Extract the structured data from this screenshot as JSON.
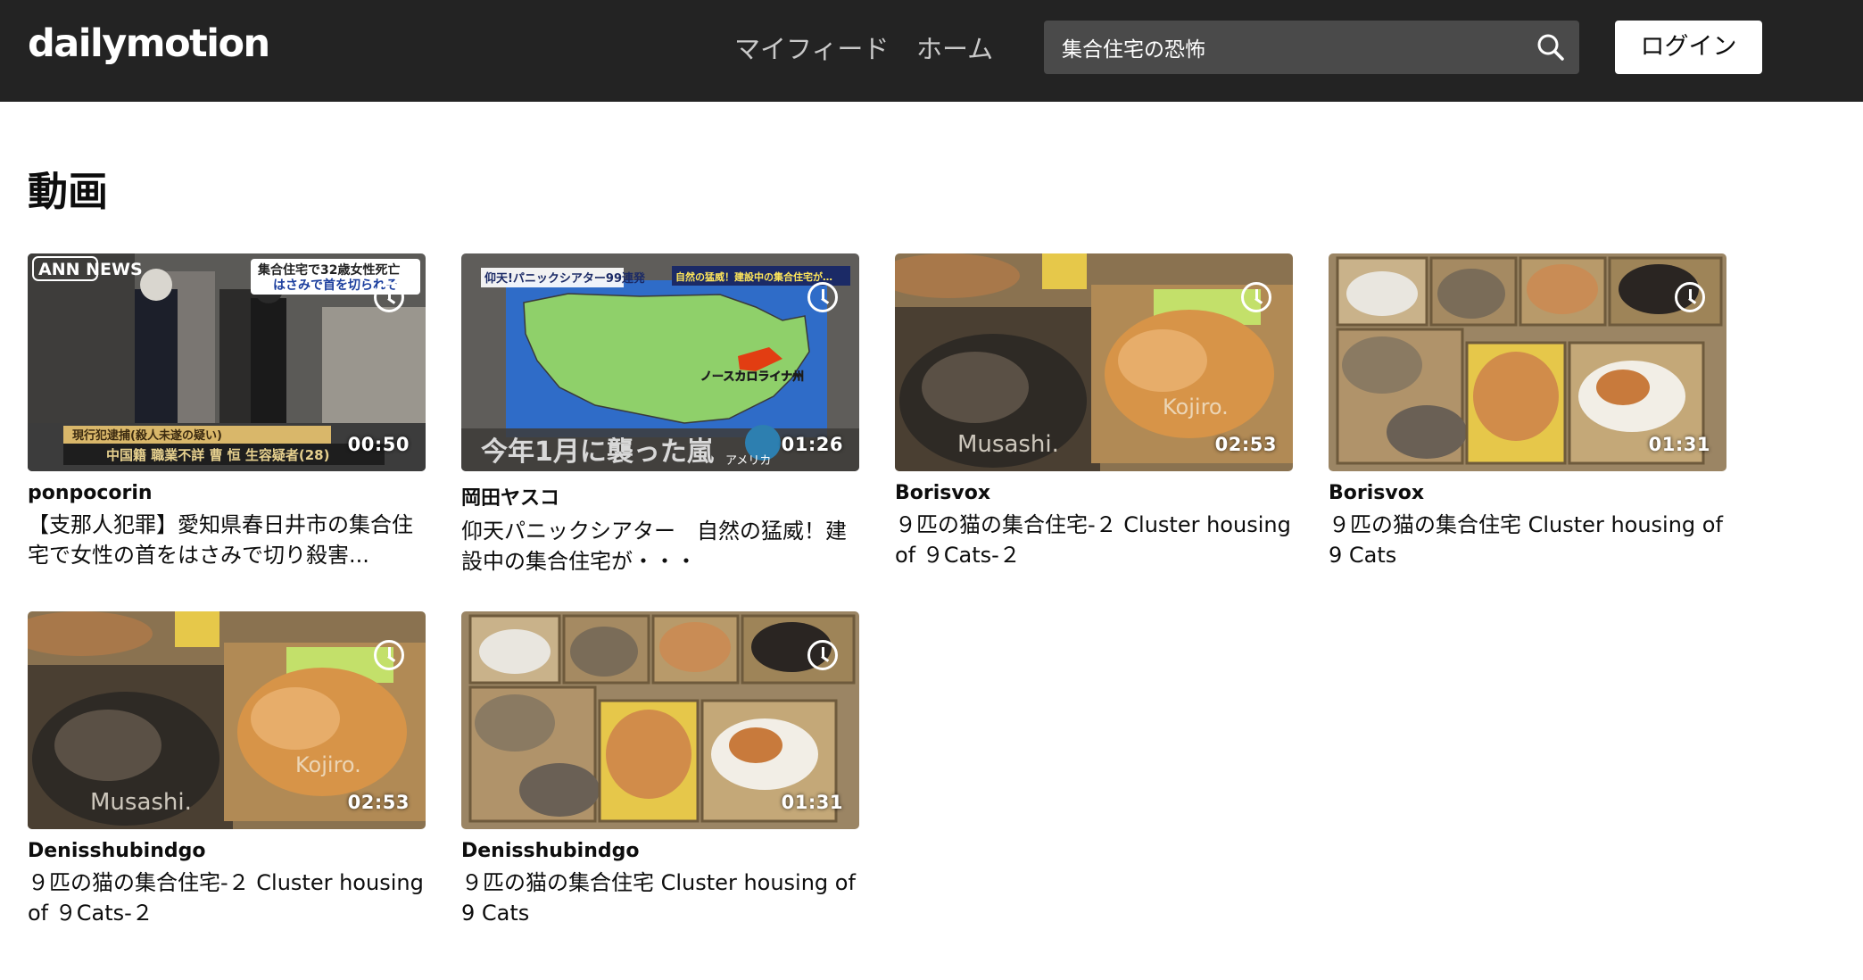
{
  "header": {
    "logo": "dailymotion",
    "nav": [
      "マイフィード",
      "ホーム"
    ],
    "search_value": "集合住宅の恐怖",
    "login_label": "ログイン"
  },
  "section_title": "動画",
  "videos": [
    {
      "owner": "ponpocorin",
      "title": "【支那人犯罪】愛知県春日井市の集合住宅で女性の首をはさみで切り殺害...",
      "duration": "00:50",
      "thumb_overlay": {
        "badge": "ANN NEWS",
        "headline_1": "集合住宅で32歳女性死亡",
        "headline_2": "はさみで首を切られそ",
        "ticker_1": "現行犯逮捕(殺人未遂の疑い)",
        "ticker_2": "中国籍 職業不詳 曹 恒 生容疑者(28)"
      }
    },
    {
      "owner": "岡田ヤスコ",
      "title": "仰天パニックシアター　自然の猛威！建設中の集合住宅が・・・",
      "duration": "01:26",
      "thumb_overlay": {
        "top_left": "仰天!パニックシアター99連発",
        "top_right": "自然の猛威！建設中の集合住宅が…",
        "map_label": "ノースカロライナ州",
        "bottom": "今年1月に襲った嵐",
        "country": "アメリカ"
      }
    },
    {
      "owner": "Borisvox",
      "title": "９匹の猫の集合住宅-２ Cluster housing of ９Cats-２",
      "duration": "02:53",
      "thumb_overlay": {
        "label_1": "Musashi.",
        "label_2": "Kojiro."
      }
    },
    {
      "owner": "Borisvox",
      "title": "９匹の猫の集合住宅 Cluster housing of 9 Cats",
      "duration": "01:31"
    },
    {
      "owner": "Denisshubindgo",
      "title": "９匹の猫の集合住宅-２ Cluster housing of ９Cats-２",
      "duration": "02:53",
      "thumb_overlay": {
        "label_1": "Musashi.",
        "label_2": "Kojiro."
      }
    },
    {
      "owner": "Denisshubindgo",
      "title": "９匹の猫の集合住宅 Cluster housing of 9 Cats",
      "duration": "01:31"
    }
  ]
}
